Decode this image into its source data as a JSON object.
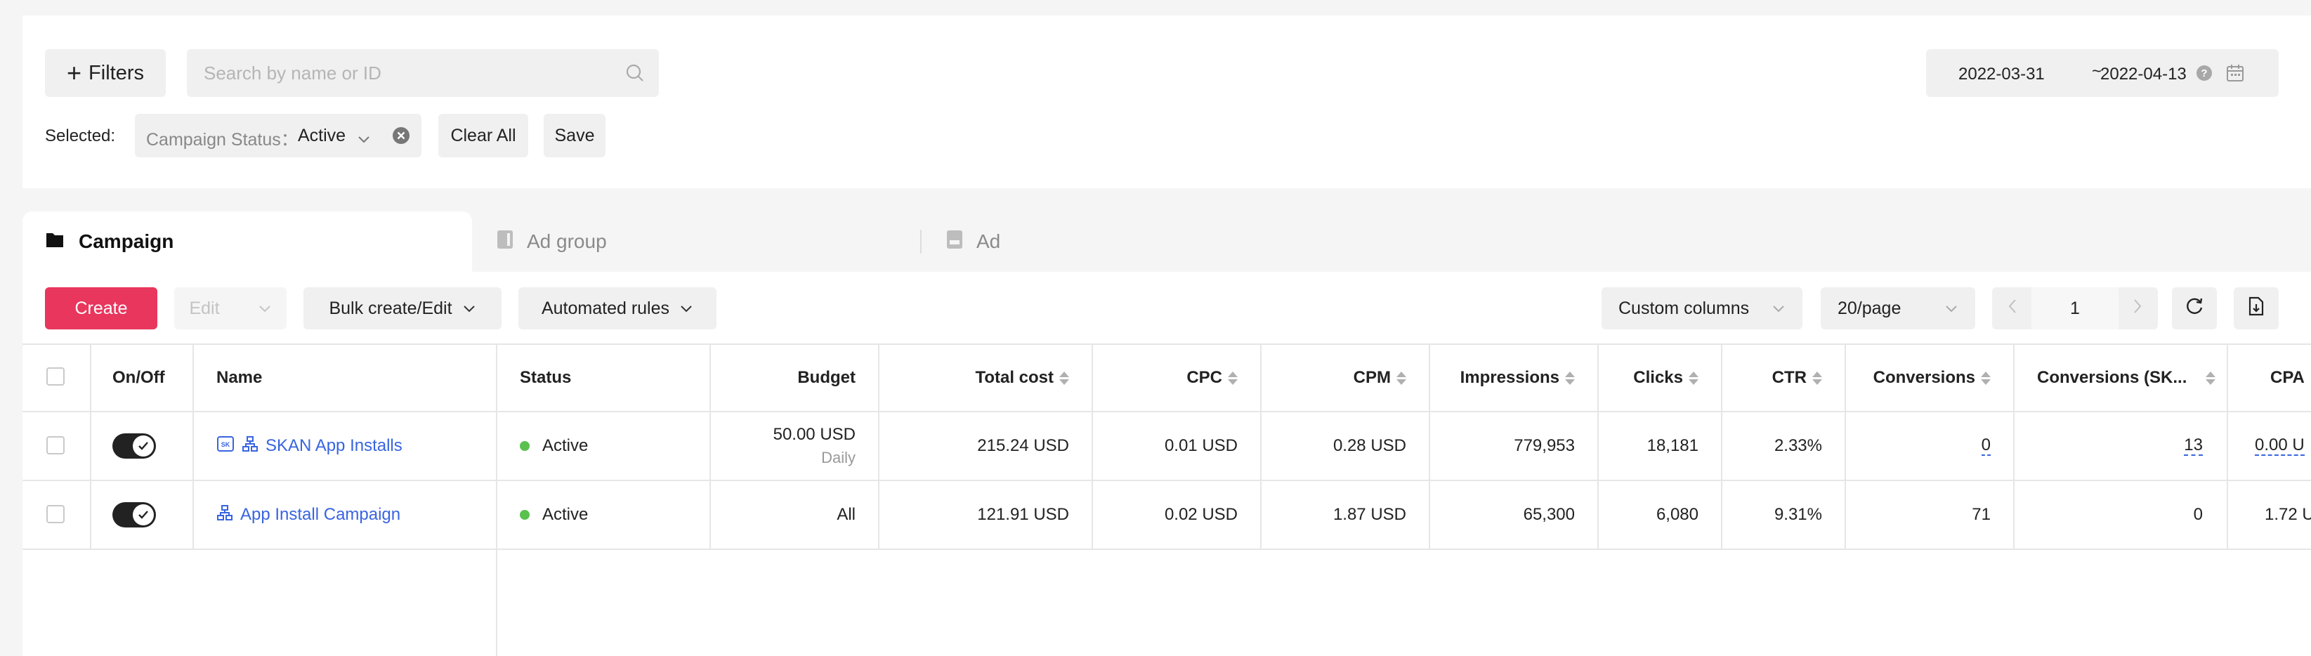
{
  "filters": {
    "filters_label": "Filters",
    "search_placeholder": "Search by name or ID",
    "date_start": "2022-03-31",
    "date_separator": "~",
    "date_end": "2022-04-13",
    "selected_label": "Selected:",
    "chip_key": "Campaign Status：",
    "chip_value": "Active",
    "clear_all": "Clear All",
    "save": "Save"
  },
  "tabs": [
    {
      "label": "Campaign",
      "active": true
    },
    {
      "label": "Ad group",
      "active": false
    },
    {
      "label": "Ad",
      "active": false
    }
  ],
  "toolbar": {
    "create": "Create",
    "edit": "Edit",
    "bulk": "Bulk create/Edit",
    "rules": "Automated rules",
    "custom_columns": "Custom columns",
    "page_size": "20/page",
    "current_page": "1"
  },
  "table": {
    "headers": {
      "onoff": "On/Off",
      "name": "Name",
      "status": "Status",
      "budget": "Budget",
      "total_cost": "Total cost",
      "cpc": "CPC",
      "cpm": "CPM",
      "impressions": "Impressions",
      "clicks": "Clicks",
      "ctr": "CTR",
      "conversions": "Conversions",
      "conversions_skan": "Conversions (SK...",
      "cpa": "CPA"
    },
    "rows": [
      {
        "on": true,
        "name": "SKAN App Installs",
        "status": "Active",
        "budget": "50.00 USD",
        "budget_type": "Daily",
        "total_cost": "215.24 USD",
        "cpc": "0.01 USD",
        "cpm": "0.28 USD",
        "impressions": "779,953",
        "clicks": "18,181",
        "ctr": "2.33%",
        "conversions": "0",
        "conversions_skan": "13",
        "cpa": "0.00 U"
      },
      {
        "on": true,
        "name": "App Install Campaign",
        "status": "Active",
        "budget": "All",
        "budget_type": "",
        "total_cost": "121.91 USD",
        "cpc": "0.02 USD",
        "cpm": "1.87 USD",
        "impressions": "65,300",
        "clicks": "6,080",
        "ctr": "9.31%",
        "conversions": "71",
        "conversions_skan": "0",
        "cpa": "1.72 U"
      }
    ]
  },
  "colors": {
    "accent": "#e8365d",
    "link": "#3864e0",
    "status_active": "#5ac04e"
  },
  "icons": [
    "plus-icon",
    "search-icon",
    "help-icon",
    "calendar-icon",
    "chevron-down-icon",
    "clear-icon",
    "folder-icon",
    "document-icon",
    "skan-icon",
    "hierarchy-icon",
    "refresh-icon",
    "export-icon",
    "check-icon",
    "sort-icon"
  ]
}
